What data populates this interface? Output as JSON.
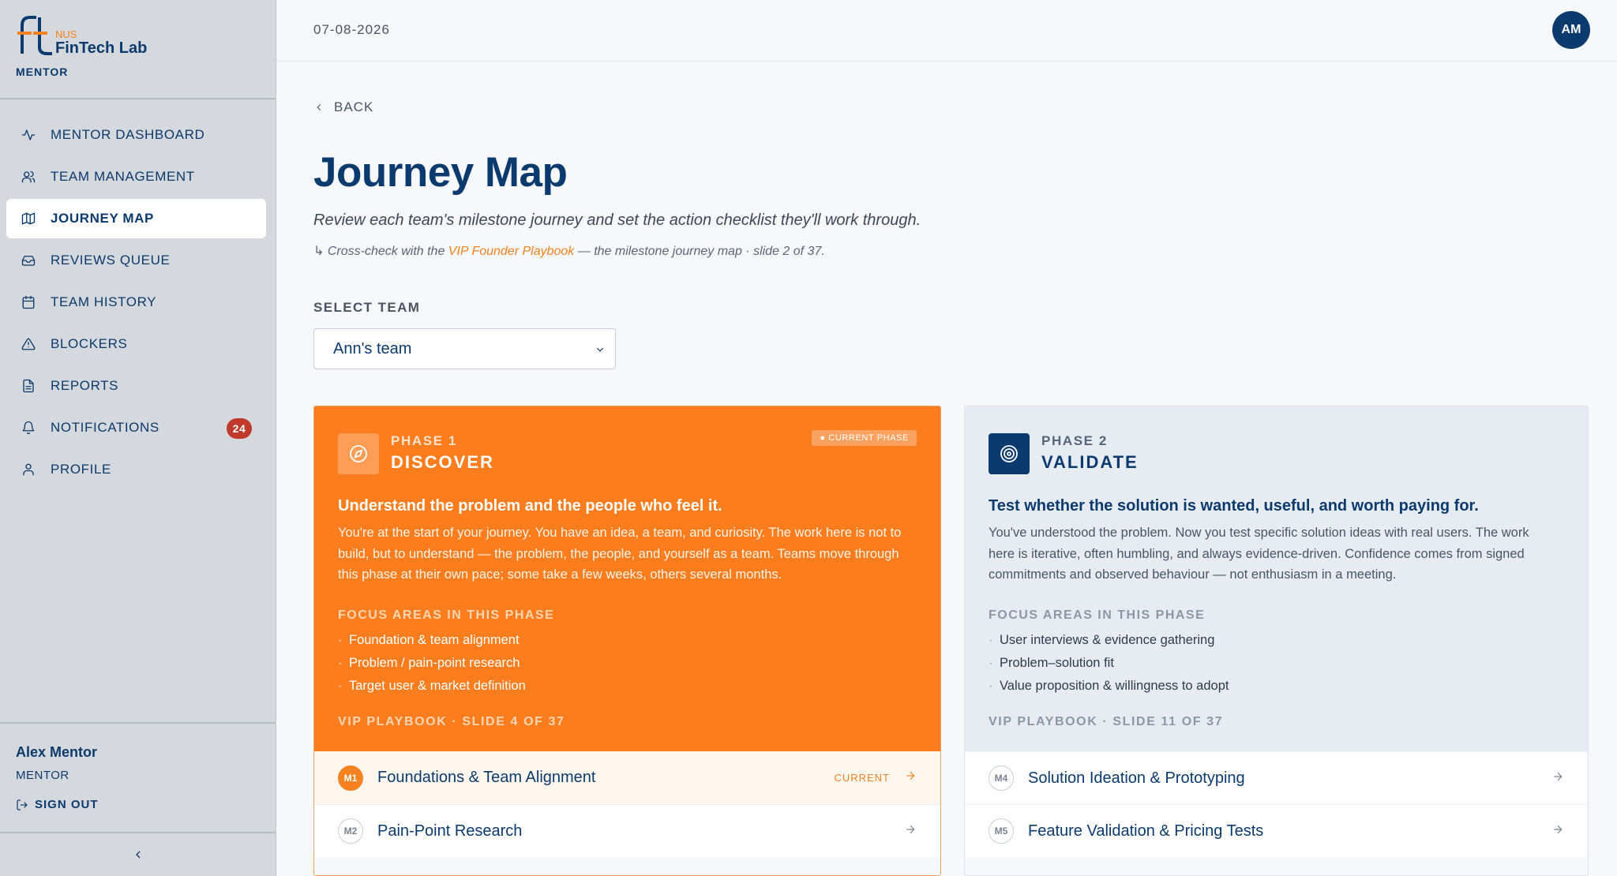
{
  "brand": {
    "logo_mark": "ft",
    "org": "NUS",
    "name": "FinTech Lab",
    "role": "MENTOR"
  },
  "sidebar": {
    "items": [
      {
        "label": "MENTOR DASHBOARD",
        "icon": "activity-icon",
        "active": false
      },
      {
        "label": "TEAM MANAGEMENT",
        "icon": "users-icon",
        "active": false
      },
      {
        "label": "JOURNEY MAP",
        "icon": "map-icon",
        "active": true
      },
      {
        "label": "REVIEWS QUEUE",
        "icon": "inbox-icon",
        "active": false
      },
      {
        "label": "TEAM HISTORY",
        "icon": "calendar-icon",
        "active": false
      },
      {
        "label": "BLOCKERS",
        "icon": "alert-triangle-icon",
        "active": false
      },
      {
        "label": "REPORTS",
        "icon": "file-text-icon",
        "active": false
      },
      {
        "label": "NOTIFICATIONS",
        "icon": "bell-icon",
        "active": false,
        "badge": "24"
      },
      {
        "label": "PROFILE",
        "icon": "user-icon",
        "active": false
      }
    ],
    "user": {
      "name": "Alex Mentor",
      "role": "MENTOR",
      "signout_label": "SIGN OUT"
    }
  },
  "header": {
    "date": "07-08-2026",
    "avatar_initials": "AM"
  },
  "main": {
    "back_label": "BACK",
    "title": "Journey Map",
    "subtitle": "Review each team's milestone journey and set the action checklist they'll work through.",
    "crosscheck": {
      "prefix": "↳ Cross-check with the ",
      "link": "VIP Founder Playbook",
      "suffix": " — the milestone journey map · slide 2 of 37."
    },
    "select_label": "SELECT TEAM",
    "selected_team": "Ann's team"
  },
  "phases": [
    {
      "number": "PHASE 1",
      "name": "DISCOVER",
      "current_pill": "● CURRENT PHASE",
      "tagline": "Understand the problem and the people who feel it.",
      "description": "You're at the start of your journey. You have an idea, a team, and curiosity. The work here is not to build, but to understand — the problem, the people, and yourself as a team. Teams move through this phase at their own pace; some take a few weeks, others several months.",
      "focus_label": "FOCUS AREAS IN THIS PHASE",
      "focus": [
        "Foundation & team alignment",
        "Problem / pain-point research",
        "Target user & market definition"
      ],
      "playbook": "VIP PLAYBOOK · SLIDE 4 OF 37",
      "milestones": [
        {
          "code": "M1",
          "title": "Foundations & Team Alignment",
          "status": "CURRENT"
        },
        {
          "code": "M2",
          "title": "Pain-Point Research",
          "status": ""
        }
      ],
      "accent": "#fc7d1e"
    },
    {
      "number": "PHASE 2",
      "name": "VALIDATE",
      "tagline": "Test whether the solution is wanted, useful, and worth paying for.",
      "description": "You've understood the problem. Now you test specific solution ideas with real users. The work here is iterative, often humbling, and always evidence-driven. Confidence comes from signed commitments and observed behaviour — not enthusiasm in a meeting.",
      "focus_label": "FOCUS AREAS IN THIS PHASE",
      "focus": [
        "User interviews & evidence gathering",
        "Problem–solution fit",
        "Value proposition & willingness to adopt"
      ],
      "playbook": "VIP PLAYBOOK · SLIDE 11 OF 37",
      "milestones": [
        {
          "code": "M4",
          "title": "Solution Ideation & Prototyping",
          "status": ""
        },
        {
          "code": "M5",
          "title": "Feature Validation & Pricing Tests",
          "status": ""
        }
      ],
      "accent": "#0b3a6e"
    }
  ],
  "colors": {
    "brand_navy": "#0b3a6e",
    "brand_orange": "#f58220",
    "badge_red": "#c0392b"
  }
}
